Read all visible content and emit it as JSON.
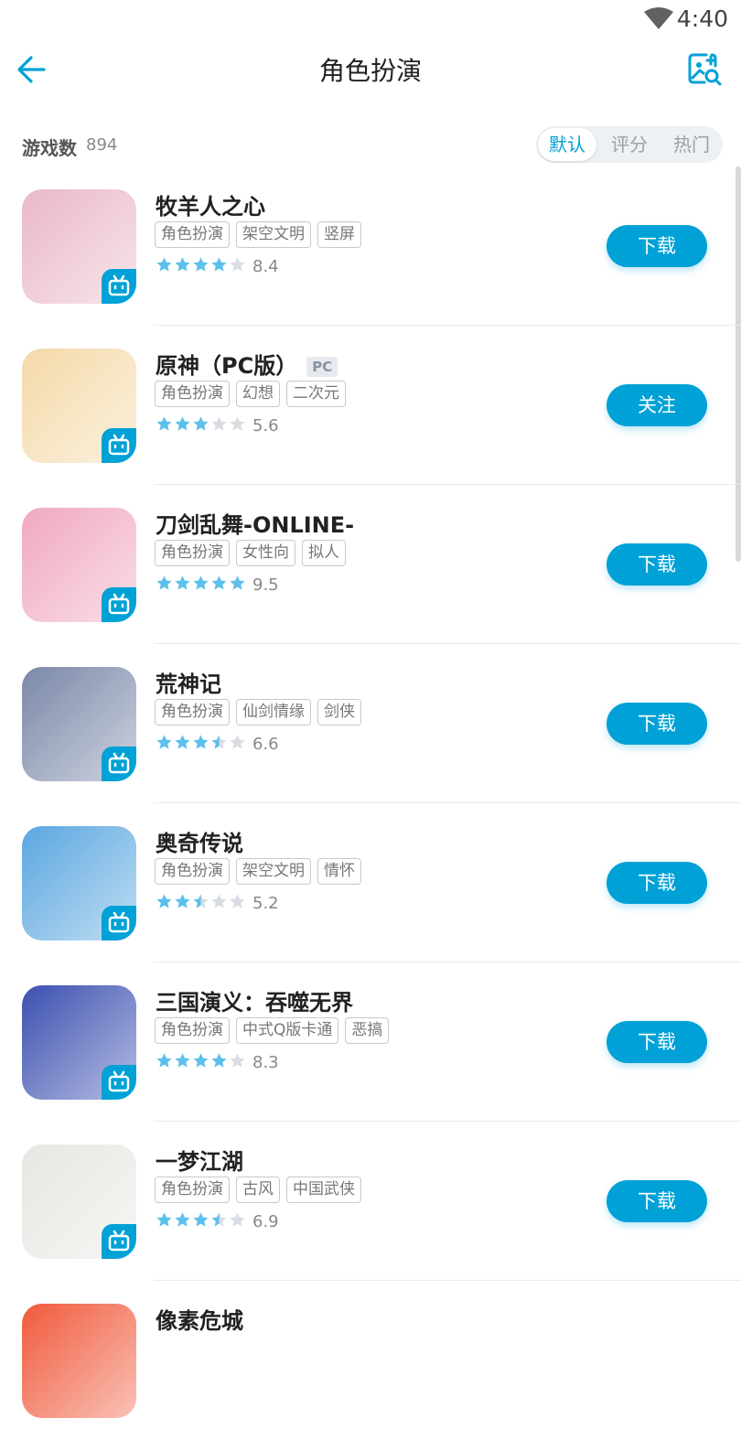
{
  "status": {
    "time": "4:40"
  },
  "header": {
    "title": "角色扮演"
  },
  "summary": {
    "count_label": "游戏数",
    "count_value": "894"
  },
  "sort_tabs": [
    {
      "label": "默认",
      "active": true
    },
    {
      "label": "评分",
      "active": false
    },
    {
      "label": "热门",
      "active": false
    }
  ],
  "games": [
    {
      "name": "牧羊人之心",
      "platform": "",
      "tags": [
        "角色扮演",
        "架空文明",
        "竖屏"
      ],
      "stars": 4,
      "score": "8.4",
      "action": "下载"
    },
    {
      "name": "原神（PC版）",
      "platform": "PC",
      "tags": [
        "角色扮演",
        "幻想",
        "二次元"
      ],
      "stars": 3,
      "score": "5.6",
      "action": "关注"
    },
    {
      "name": "刀剑乱舞-ONLINE-",
      "platform": "",
      "tags": [
        "角色扮演",
        "女性向",
        "拟人"
      ],
      "stars": 5,
      "score": "9.5",
      "action": "下载"
    },
    {
      "name": "荒神记",
      "platform": "",
      "tags": [
        "角色扮演",
        "仙剑情缘",
        "剑侠"
      ],
      "stars": 3.5,
      "score": "6.6",
      "action": "下载"
    },
    {
      "name": "奥奇传说",
      "platform": "",
      "tags": [
        "角色扮演",
        "架空文明",
        "情怀"
      ],
      "stars": 2.5,
      "score": "5.2",
      "action": "下载"
    },
    {
      "name": "三国演义：吞噬无界",
      "platform": "",
      "tags": [
        "角色扮演",
        "中式Q版卡通",
        "恶搞"
      ],
      "stars": 4,
      "score": "8.3",
      "action": "下载"
    },
    {
      "name": "一梦江湖",
      "platform": "",
      "tags": [
        "角色扮演",
        "古风",
        "中国武侠"
      ],
      "stars": 3.5,
      "score": "6.9",
      "action": "下载"
    },
    {
      "name": "像素危城",
      "platform": "",
      "tags": [],
      "stars": 0,
      "score": "",
      "action": ""
    }
  ],
  "colors": {
    "accent": "#00a1d6",
    "star_filled": "#5bc0eb",
    "star_empty": "#d8dde3",
    "icons": [
      "#e9b8c6",
      "#f4d9a8",
      "#f0a8c0",
      "#7a88a8",
      "#5aa7e0",
      "#3b4fb0",
      "#e8e6e2",
      "#f05a3c"
    ]
  }
}
